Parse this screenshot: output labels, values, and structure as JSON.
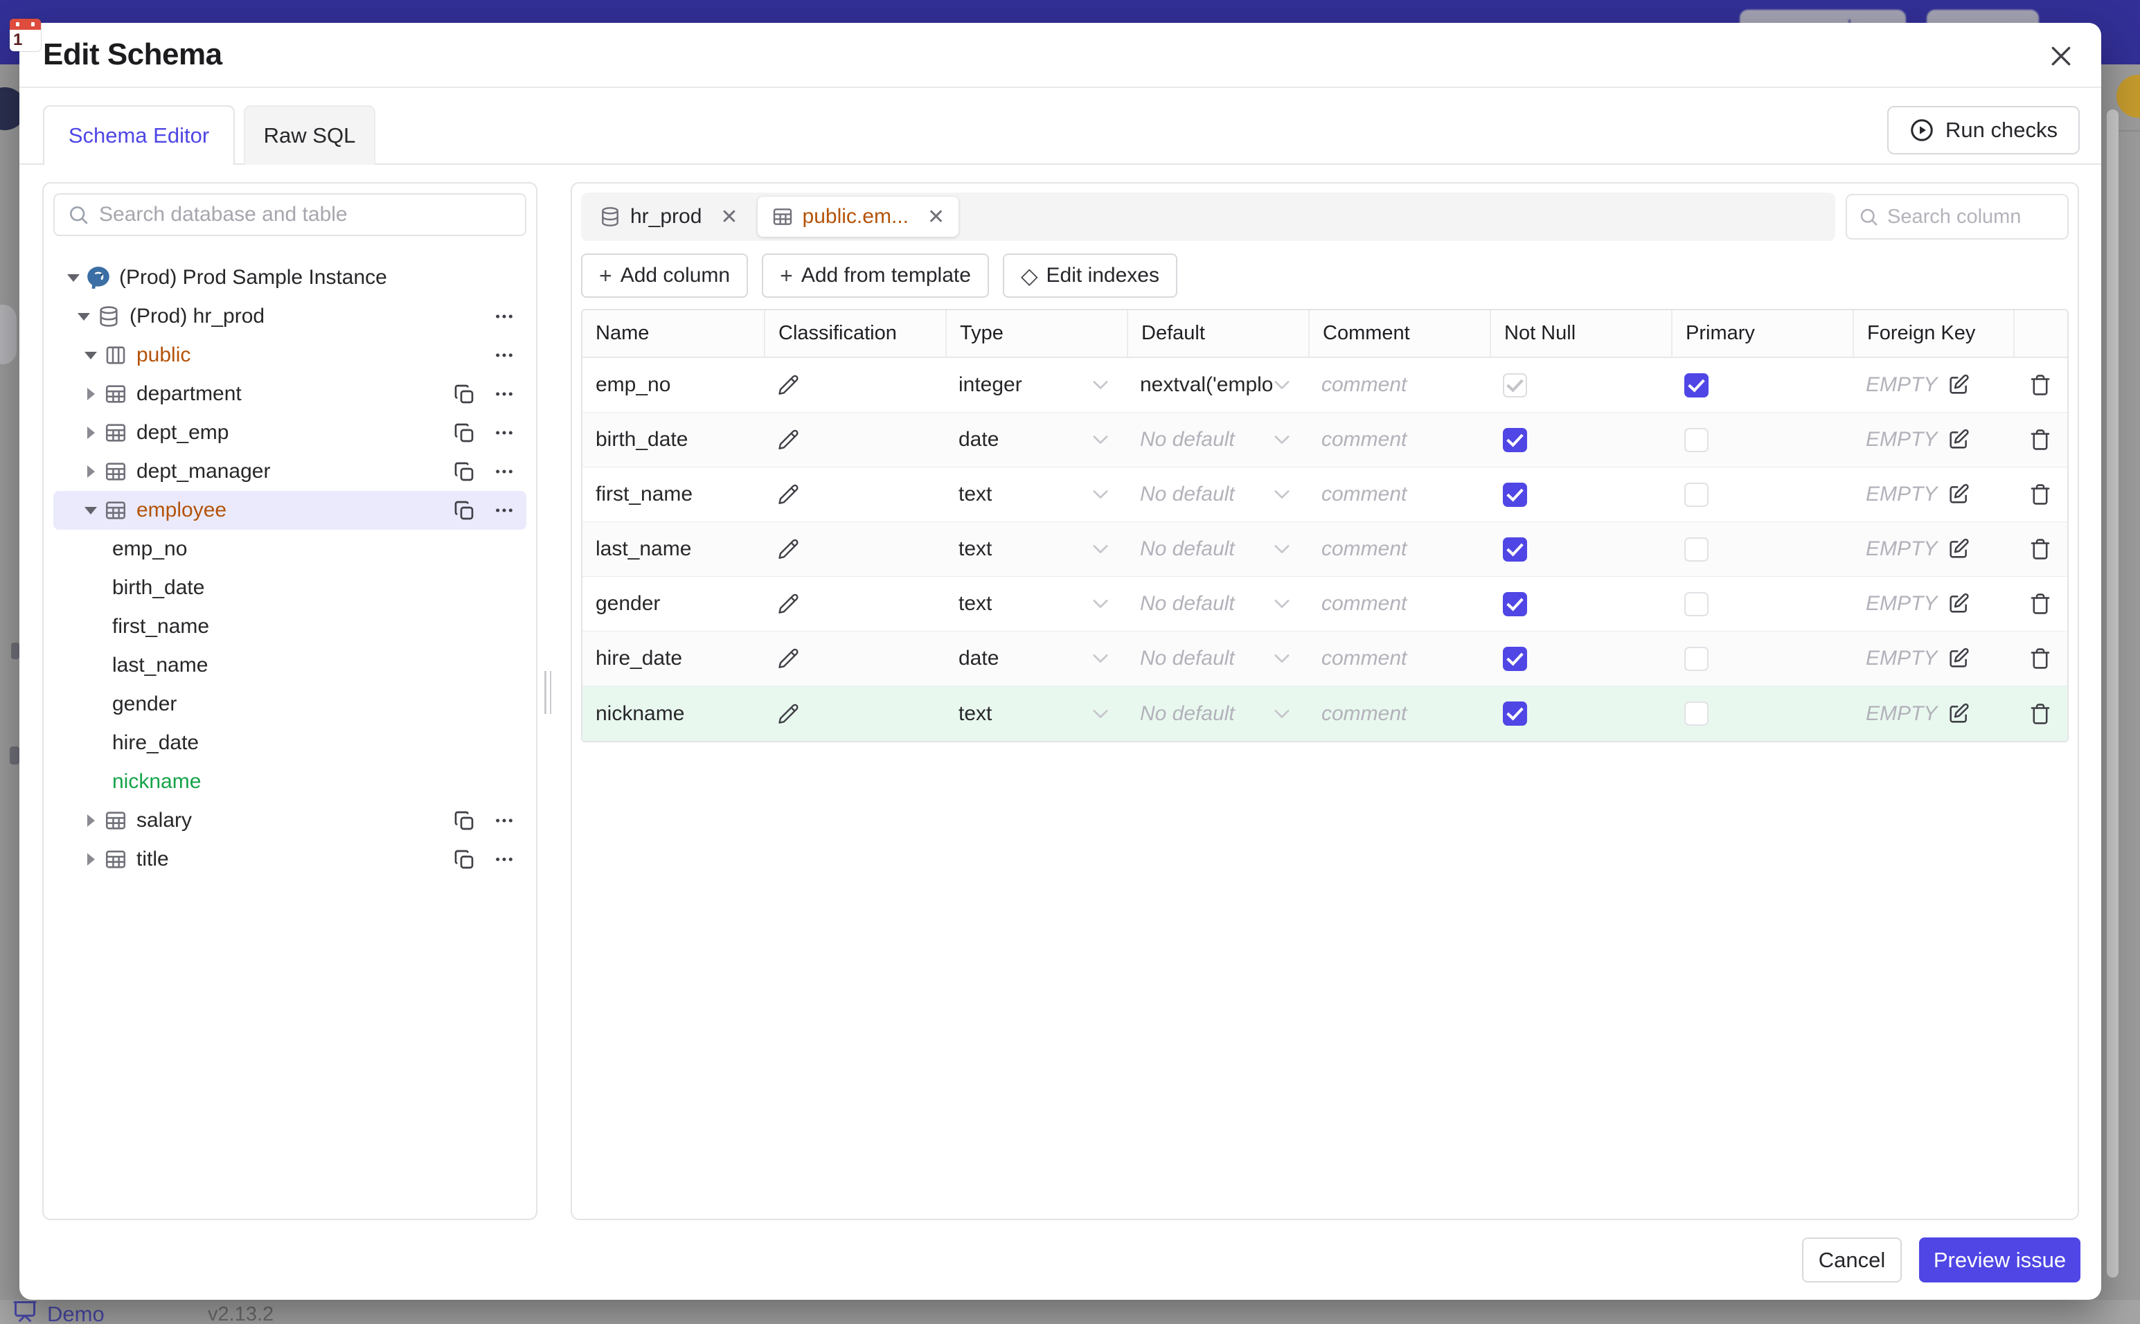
{
  "page": {
    "demo_label": "Demo",
    "version": "v2.13.2"
  },
  "modal": {
    "title": "Edit Schema",
    "tabs": [
      {
        "label": "Schema Editor",
        "active": true
      },
      {
        "label": "Raw SQL",
        "active": false
      }
    ],
    "run_checks_label": "Run checks",
    "cancel_label": "Cancel",
    "preview_label": "Preview issue"
  },
  "sidebar": {
    "search_placeholder": "Search database and table",
    "tree": [
      {
        "label": "(Prod) Prod Sample Instance",
        "kind": "instance",
        "level": 0,
        "caret": "expanded",
        "copy": false,
        "menu": false,
        "highlight": null,
        "selected": false
      },
      {
        "label": "(Prod) hr_prod",
        "kind": "database",
        "level": 1,
        "caret": "expanded",
        "copy": false,
        "menu": true,
        "highlight": null,
        "selected": false
      },
      {
        "label": "public",
        "kind": "schema",
        "level": 2,
        "caret": "expanded",
        "copy": false,
        "menu": true,
        "highlight": "orange",
        "selected": false
      },
      {
        "label": "department",
        "kind": "table",
        "level": 3,
        "caret": "collapsed",
        "copy": true,
        "menu": true,
        "highlight": null,
        "selected": false
      },
      {
        "label": "dept_emp",
        "kind": "table",
        "level": 3,
        "caret": "collapsed",
        "copy": true,
        "menu": true,
        "highlight": null,
        "selected": false
      },
      {
        "label": "dept_manager",
        "kind": "table",
        "level": 3,
        "caret": "collapsed",
        "copy": true,
        "menu": true,
        "highlight": null,
        "selected": false
      },
      {
        "label": "employee",
        "kind": "table",
        "level": 3,
        "caret": "expanded",
        "copy": true,
        "menu": true,
        "highlight": "orange",
        "selected": true
      },
      {
        "label": "emp_no",
        "kind": "column",
        "level": 4,
        "caret": null,
        "copy": false,
        "menu": false,
        "highlight": null,
        "selected": false
      },
      {
        "label": "birth_date",
        "kind": "column",
        "level": 4,
        "caret": null,
        "copy": false,
        "menu": false,
        "highlight": null,
        "selected": false
      },
      {
        "label": "first_name",
        "kind": "column",
        "level": 4,
        "caret": null,
        "copy": false,
        "menu": false,
        "highlight": null,
        "selected": false
      },
      {
        "label": "last_name",
        "kind": "column",
        "level": 4,
        "caret": null,
        "copy": false,
        "menu": false,
        "highlight": null,
        "selected": false
      },
      {
        "label": "gender",
        "kind": "column",
        "level": 4,
        "caret": null,
        "copy": false,
        "menu": false,
        "highlight": null,
        "selected": false
      },
      {
        "label": "hire_date",
        "kind": "column",
        "level": 4,
        "caret": null,
        "copy": false,
        "menu": false,
        "highlight": null,
        "selected": false
      },
      {
        "label": "nickname",
        "kind": "column",
        "level": 4,
        "caret": null,
        "copy": false,
        "menu": false,
        "highlight": "green",
        "selected": false
      },
      {
        "label": "salary",
        "kind": "table",
        "level": 3,
        "caret": "collapsed",
        "copy": true,
        "menu": true,
        "highlight": null,
        "selected": false
      },
      {
        "label": "title",
        "kind": "table",
        "level": 3,
        "caret": "collapsed",
        "copy": true,
        "menu": true,
        "highlight": null,
        "selected": false
      }
    ]
  },
  "editor": {
    "chips": [
      {
        "label": "hr_prod",
        "icon": "database-icon",
        "active": false
      },
      {
        "label": "public.em...",
        "icon": "table-icon",
        "active": true
      }
    ],
    "search_placeholder": "Search column",
    "toolbar": {
      "add_column": "Add column",
      "add_from_template": "Add from template",
      "edit_indexes": "Edit indexes"
    }
  },
  "table": {
    "headers": [
      "Name",
      "Classification",
      "Type",
      "Default",
      "Comment",
      "Not Null",
      "Primary",
      "Foreign Key"
    ],
    "placeholders": {
      "comment": "comment",
      "no_default": "No default",
      "foreign_key_empty": "EMPTY"
    },
    "rows": [
      {
        "name": "emp_no",
        "type": "integer",
        "default": "nextval('employ",
        "not_null": "disabled-checked",
        "primary": "checked",
        "is_new": false
      },
      {
        "name": "birth_date",
        "type": "date",
        "default": null,
        "not_null": "checked",
        "primary": "unchecked",
        "is_new": false
      },
      {
        "name": "first_name",
        "type": "text",
        "default": null,
        "not_null": "checked",
        "primary": "unchecked",
        "is_new": false
      },
      {
        "name": "last_name",
        "type": "text",
        "default": null,
        "not_null": "checked",
        "primary": "unchecked",
        "is_new": false
      },
      {
        "name": "gender",
        "type": "text",
        "default": null,
        "not_null": "checked",
        "primary": "unchecked",
        "is_new": false
      },
      {
        "name": "hire_date",
        "type": "date",
        "default": null,
        "not_null": "checked",
        "primary": "unchecked",
        "is_new": false
      },
      {
        "name": "nickname",
        "type": "text",
        "default": null,
        "not_null": "checked",
        "primary": "unchecked",
        "is_new": true
      }
    ]
  },
  "colors": {
    "accent": "#4f46e5",
    "selected_schema_text": "#b45309",
    "new_item_text": "#16a34a",
    "new_row_bg": "#e9f8ef",
    "selected_row_bg": "#eaeafc",
    "top_bar": "#322f96"
  }
}
